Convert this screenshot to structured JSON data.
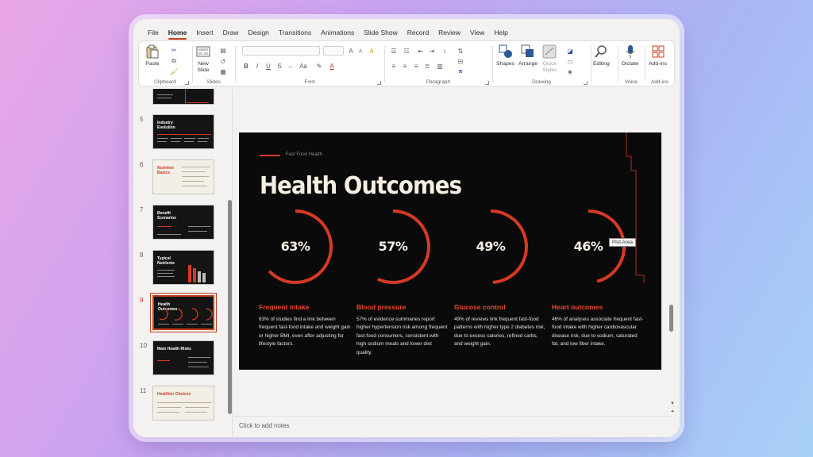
{
  "menu": [
    "File",
    "Home",
    "Insert",
    "Draw",
    "Design",
    "Transitions",
    "Animations",
    "Slide Show",
    "Record",
    "Review",
    "View",
    "Help"
  ],
  "menu_active": "Home",
  "ribbon": {
    "clipboard": {
      "label": "Clipboard",
      "paste": "Paste"
    },
    "slides": {
      "label": "Slides",
      "new_slide": "New\nSlide"
    },
    "font": {
      "label": "Font"
    },
    "paragraph": {
      "label": "Paragraph"
    },
    "drawing": {
      "label": "Drawing",
      "shapes": "Shapes",
      "arrange": "Arrange",
      "quick_styles": "Quick\nStyles"
    },
    "editing": {
      "label": "Editing"
    },
    "voice": {
      "label": "Voice",
      "dictate": "Dictate"
    },
    "addins": {
      "label": "Add-ins",
      "button": "Add-ins"
    }
  },
  "thumbnails": [
    {
      "num": "",
      "title": ""
    },
    {
      "num": "5",
      "title": "Industry Evolution"
    },
    {
      "num": "6",
      "title": "Nutrition Basics"
    },
    {
      "num": "7",
      "title": "Benefit Scenarios"
    },
    {
      "num": "8",
      "title": "Typical Nutrients"
    },
    {
      "num": "9",
      "title": "Health Outcomes"
    },
    {
      "num": "10",
      "title": "Main Health Risks"
    },
    {
      "num": "11",
      "title": "Healthier Choices"
    }
  ],
  "slide": {
    "kicker": "Fast Food Health",
    "title": "Health Outcomes",
    "gauges": [
      {
        "pct": "63%",
        "value": 0.63,
        "head": "Frequent intake",
        "body": "63% of studies find a link between frequent fast-food intake and weight gain or higher BMI, even after adjusting for lifestyle factors."
      },
      {
        "pct": "57%",
        "value": 0.57,
        "head": "Blood pressure",
        "body": "57% of evidence summaries report higher hypertension risk among frequent fast-food consumers, consistent with high sodium meals and lower diet quality."
      },
      {
        "pct": "49%",
        "value": 0.49,
        "head": "Glucose control",
        "body": "49% of reviews link frequent fast-food patterns with higher type 2 diabetes risk, due to excess calories, refined carbs, and weight gain."
      },
      {
        "pct": "46%",
        "value": 0.46,
        "head": "Heart outcomes",
        "body": "46% of analyses associate frequent fast-food intake with higher cardiovascular disease risk, due to sodium, saturated fat, and low fiber intake."
      }
    ],
    "tooltip": "Plot Area"
  },
  "notes": "Click to add notes",
  "colors": {
    "accent": "#d63a24",
    "ribbon_active": "#c43e1c"
  }
}
